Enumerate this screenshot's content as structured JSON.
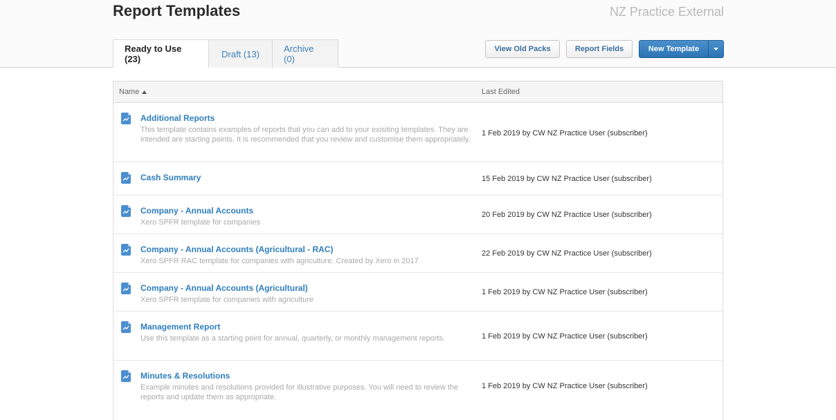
{
  "header": {
    "title": "Report Templates",
    "org_name": "NZ Practice External"
  },
  "tabs": [
    {
      "label": "Ready to Use (23)",
      "active": true
    },
    {
      "label": "Draft (13)",
      "active": false
    },
    {
      "label": "Archive (0)",
      "active": false
    }
  ],
  "toolbar": {
    "view_old_packs": "View Old Packs",
    "report_fields": "Report Fields",
    "new_template": "New Template"
  },
  "table": {
    "columns": {
      "name": "Name",
      "last_edited": "Last Edited"
    },
    "rows": [
      {
        "name": "Additional Reports",
        "description": "This template contains examples of reports that you can add to your exisiting templates. They are intended are starting points. It is recommended that you review and customise them appropriately.",
        "last_edited": "1 Feb 2019 by CW NZ Practice User (subscriber)"
      },
      {
        "name": "Cash Summary",
        "description": "",
        "last_edited": "15 Feb 2019 by CW NZ Practice User (subscriber)"
      },
      {
        "name": "Company - Annual Accounts",
        "description": "Xero SPFR template for companies",
        "last_edited": "20 Feb 2019 by CW NZ Practice User (subscriber)"
      },
      {
        "name": "Company - Annual Accounts (Agricultural - RAC)",
        "description": "Xero SPFR RAC template for companies with agriculture. Created by Xero in 2017",
        "last_edited": "22 Feb 2019 by CW NZ Practice User (subscriber)"
      },
      {
        "name": "Company - Annual Accounts (Agricultural)",
        "description": "Xero SPFR template for companies with agriculture",
        "last_edited": "1 Feb 2019 by CW NZ Practice User (subscriber)"
      },
      {
        "name": "Management Report",
        "description": "Use this template as a starting point for annual, quarterly, or monthly management reports.",
        "last_edited": "1 Feb 2019 by CW NZ Practice User (subscriber)"
      },
      {
        "name": "Minutes & Resolutions",
        "description": "Example minutes and resolutions provided for illustrative purposes. You will need to review the reports and update them as appropriate.",
        "last_edited": "1 Feb 2019 by CW NZ Practice User (subscriber)"
      }
    ]
  },
  "icons": {
    "template_icon": "report-chart-icon",
    "sort": "sort-ascending-icon",
    "dropdown": "chevron-down-icon"
  },
  "colors": {
    "link": "#2f7ebd",
    "primary_button": "#2c73b4",
    "icon": "#4a8fcf"
  }
}
